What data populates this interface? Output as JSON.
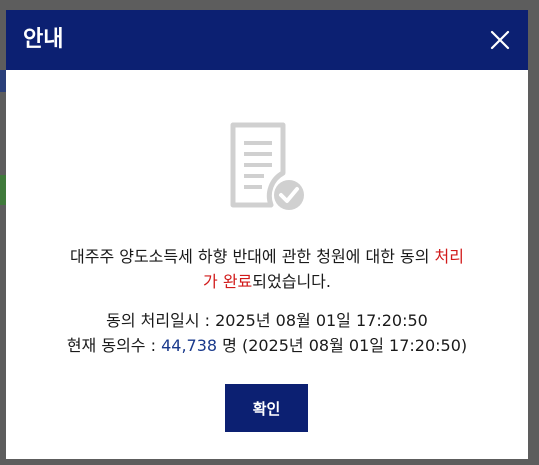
{
  "dialog": {
    "title": "안내",
    "close_icon": "close-icon",
    "document_icon": "document-check-icon",
    "message": {
      "line1": "대주주 양도소득세 하향 반대에 관한 청원에 대한 동의 ",
      "highlight1": "처리",
      "highlight2": "가 완료",
      "line2_rest": "되었습니다."
    },
    "processed_label": "동의 처리일시 : ",
    "processed_datetime": "2025년 08월 01일 17:20:50",
    "count_label": "현재 동의수 : ",
    "count_value": "44,738",
    "count_suffix": " 명 (2025년 08월 01일 17:20:50)",
    "confirm_label": "확인"
  },
  "colors": {
    "header": "#0c2072",
    "highlight_red": "#d11a1a",
    "count_blue": "#1a3a8c",
    "icon_gray": "#d0d0d0"
  }
}
